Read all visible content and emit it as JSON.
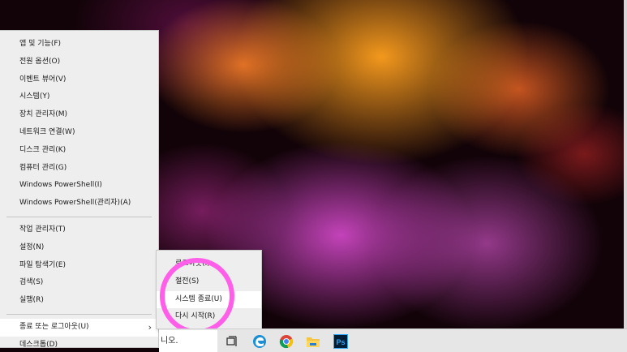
{
  "winx_menu": {
    "group1": [
      "앱 및 기능(F)",
      "전원 옵션(O)",
      "이벤트 뷰어(V)",
      "시스템(Y)",
      "장치 관리자(M)",
      "네트워크 연결(W)",
      "디스크 관리(K)",
      "컴퓨터 관리(G)",
      "Windows PowerShell(I)",
      "Windows PowerShell(관리자)(A)"
    ],
    "group2": [
      "작업 관리자(T)",
      "설정(N)",
      "파일 탐색기(E)",
      "검색(S)",
      "실행(R)"
    ],
    "shutdown_label": "종료 또는 로그아웃(U)",
    "desktop_label": "데스크톱(D)"
  },
  "submenu": {
    "items": [
      "로그아웃(I)",
      "절전(S)",
      "시스템 종료(U)",
      "다시 시작(R)"
    ]
  },
  "taskbar": {
    "search_text": "니오.",
    "icons": [
      "task-view-icon",
      "edge-icon",
      "chrome-icon",
      "file-explorer-icon",
      "photoshop-icon"
    ],
    "photoshop_label": "Ps"
  },
  "colors": {
    "menu_bg": "#eeeeee",
    "menu_highlight": "#ffffff",
    "annotation_ring": "#ff5ee8",
    "photoshop": "#31a8ff"
  }
}
